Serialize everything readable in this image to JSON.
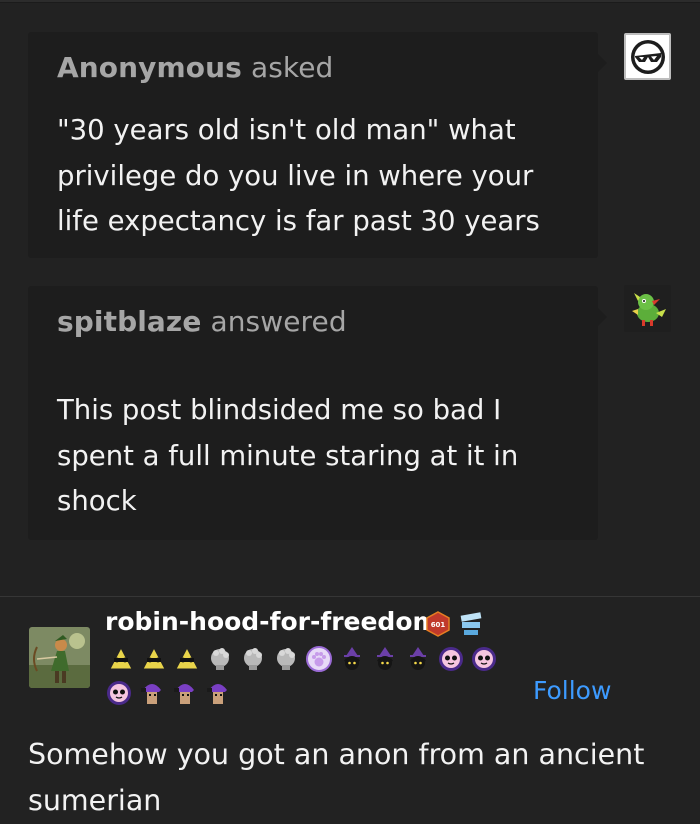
{
  "ask": {
    "asker_name": "Anonymous",
    "asker_verb": "asked",
    "question": "\"30 years old isn't old man\" what privilege do you live in where your life expectancy is far past 30 years"
  },
  "answer": {
    "answerer_name": "spitblaze",
    "answerer_verb": "answered",
    "text": "This post blindsided me so bad I spent a full minute staring at it in shock"
  },
  "reblog": {
    "username": "robin-hood-for-freedom",
    "level_badge": "601",
    "follow_label": "Follow",
    "text": "Somehow you got an anon from an ancient sumerian"
  },
  "badges_row1": [
    "triangle-glasses-icon",
    "triangle-glasses-icon",
    "triangle-glasses-icon",
    "statue-head-icon",
    "statue-head-icon",
    "statue-head-icon",
    "paw-icon",
    "witch-cat-icon",
    "witch-cat-icon",
    "witch-cat-icon",
    "pink-ghost-icon",
    "pink-ghost-icon"
  ],
  "badges_row2": [
    "pink-ghost-icon",
    "purple-hair-icon",
    "purple-hair-icon",
    "purple-hair-icon"
  ],
  "colors": {
    "background": "#222222",
    "bubble": "#1d1d1d",
    "follow": "#3d9bff",
    "muted_text": "#a6a6a6"
  }
}
